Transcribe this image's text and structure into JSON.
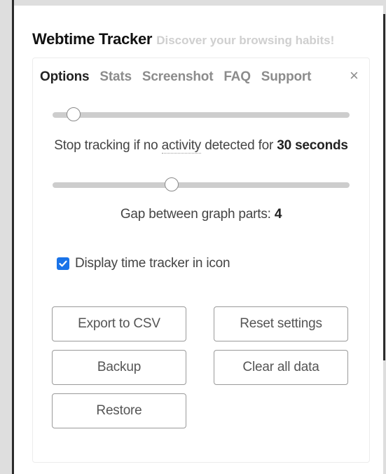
{
  "app": {
    "title": "Webtime Tracker",
    "tagline": "Discover your browsing habits!"
  },
  "tabs": [
    {
      "label": "Options",
      "active": true
    },
    {
      "label": "Stats",
      "active": false
    },
    {
      "label": "Screenshot",
      "active": false
    },
    {
      "label": "FAQ",
      "active": false
    },
    {
      "label": "Support",
      "active": false
    }
  ],
  "close_icon": "×",
  "idle_slider": {
    "level": 0.07,
    "caption_prefix": "Stop tracking if no",
    "caption_dotted": "activity",
    "caption_middle": "detected for",
    "caption_value": "30 seconds"
  },
  "gap_slider": {
    "level": 0.4,
    "caption_prefix": "Gap between graph parts:",
    "caption_value": "4"
  },
  "display_icon": {
    "label": "Display time tracker in icon",
    "checked": true
  },
  "buttons": {
    "export_csv": "Export to CSV",
    "reset_settings": "Reset settings",
    "backup": "Backup",
    "clear_all": "Clear all data",
    "restore": "Restore"
  },
  "colors": {
    "checkbox_accent": "#1a73e8",
    "tab_active": "#222222",
    "tab_inactive": "#8c8c8c",
    "tagline": "#cfcfcf"
  }
}
